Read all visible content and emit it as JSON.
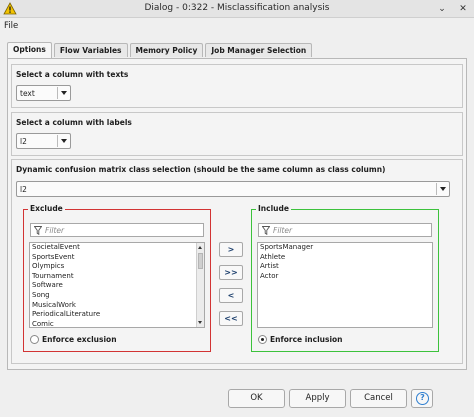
{
  "window": {
    "title": "Dialog - 0:322 - Misclassification analysis",
    "minimize_glyph": "⌄",
    "close_glyph": "✕",
    "app_icon": "warning-triangle-icon"
  },
  "menu": {
    "file": "File"
  },
  "tabs": [
    "Options",
    "Flow Variables",
    "Memory Policy",
    "Job Manager Selection"
  ],
  "options": {
    "text_column": {
      "label": "Select a column with texts",
      "value": "text"
    },
    "label_column": {
      "label": "Select a column with labels",
      "value": "l2"
    },
    "class_selection": {
      "label": "Dynamic confusion matrix class selection (should be the same column as class column)",
      "value": "l2"
    },
    "exclude": {
      "title": "Exclude",
      "filter_placeholder": "Filter",
      "items": [
        "SocietalEvent",
        "SportsEvent",
        "Olympics",
        "Tournament",
        "Software",
        "Song",
        "MusicalWork",
        "PeriodicalLiterature",
        "Comic"
      ],
      "enforce_label": "Enforce exclusion",
      "enforce_checked": false
    },
    "include": {
      "title": "Include",
      "filter_placeholder": "Filter",
      "items": [
        "SportsManager",
        "Athlete",
        "Artist",
        "Actor"
      ],
      "enforce_label": "Enforce inclusion",
      "enforce_checked": true
    },
    "move_buttons": [
      ">",
      ">>",
      "<",
      "<<"
    ]
  },
  "footer": {
    "ok": "OK",
    "apply": "Apply",
    "cancel": "Cancel",
    "help": "?"
  },
  "colors": {
    "exclude_border": "#d23434",
    "include_border": "#3cc23c",
    "help_accent": "#2f7fd0"
  }
}
